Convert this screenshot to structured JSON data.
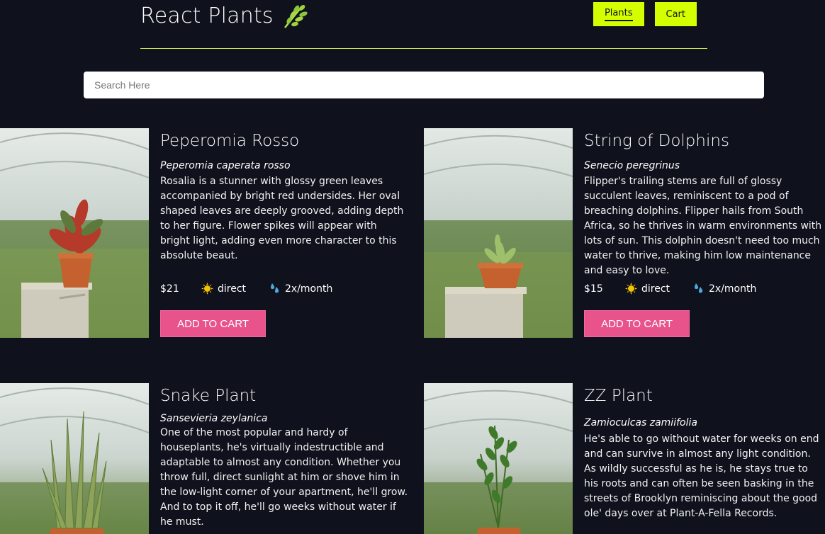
{
  "header": {
    "title": "React Plants",
    "nav": [
      {
        "label": "Plants"
      },
      {
        "label": "Cart"
      }
    ]
  },
  "search": {
    "placeholder": "Search Here",
    "value": ""
  },
  "plants": [
    {
      "name": "Peperomia Rosso",
      "scientific": "Peperomia caperata rosso",
      "description": "Rosalia is a stunner with glossy green leaves accompanied by bright red undersides. Her oval shaped leaves are deeply grooved, adding depth to her figure. Flower spikes will appear with bright light, adding even more character to this absolute beaut.",
      "price": "$21",
      "light": "direct",
      "water": "2x/month",
      "button": "ADD TO CART"
    },
    {
      "name": "String of Dolphins",
      "scientific": "Senecio peregrinus",
      "description": "Flipper's trailing stems are full of glossy succulent leaves, reminiscent to a pod of breaching dolphins. Flipper hails from South Africa, so he thrives in warm environments with lots of sun. This dolphin doesn't need too much water to thrive, making him low maintenance and easy to love.",
      "price": "$15",
      "light": "direct",
      "water": "2x/month",
      "button": "ADD TO CART"
    },
    {
      "name": "Snake Plant",
      "scientific": "Sansevieria zeylanica",
      "description": "One of the most popular and hardy of houseplants, he's virtually indestructible and adaptable to almost any condition. Whether you throw full, direct sunlight at him or shove him in the low-light corner of your apartment, he'll grow. And to top it off, he'll go weeks without water if he must."
    },
    {
      "name": "ZZ Plant",
      "scientific": "Zamioculcas zamiifolia",
      "description": "He's able to go without water for weeks on end and can survive in almost any light condition. As wildly successful as he is, he stays true to his roots and can often be seen basking in the streets of Brooklyn reminiscing about the good ole' days over at Plant-A-Fella Records."
    }
  ],
  "colors": {
    "background": "#0f111c",
    "accent": "#d4ff00",
    "button": "#e8538c"
  }
}
